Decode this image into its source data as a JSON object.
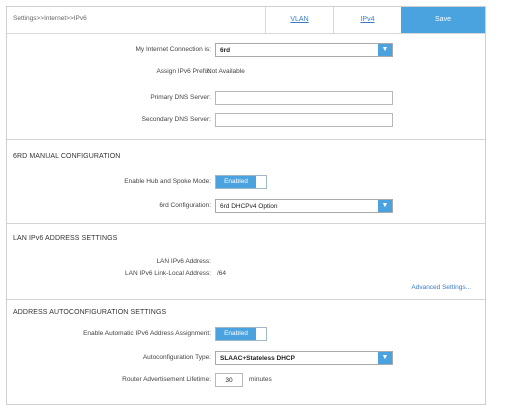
{
  "breadcrumb": "Settings>>Internet>>IPv6",
  "tabs": [
    {
      "label": "VLAN"
    },
    {
      "label": "IPv4"
    }
  ],
  "save_label": "Save",
  "connection": {
    "label": "My Internet Connection is:",
    "value": "6rd",
    "assign_label": "Assign IPv6 Prefix:",
    "assign_value": "Not Available",
    "primary_dns_label": "Primary DNS Server:",
    "primary_dns_value": "",
    "secondary_dns_label": "Secondary DNS Server:",
    "secondary_dns_value": ""
  },
  "sixrd": {
    "title": "6RD MANUAL CONFIGURATION",
    "hub_label": "Enable Hub and Spoke Mode:",
    "hub_state": "Enabled",
    "config_label": "6rd Configuration:",
    "config_value": "6rd DHCPv4 Option"
  },
  "lan": {
    "title": "LAN IPv6 ADDRESS SETTINGS",
    "address_label": "LAN IPv6 Address:",
    "address_value": "",
    "link_local_label": "LAN IPv6 Link-Local Address:",
    "link_local_value": "/64",
    "advanced_link": "Advanced Settings..."
  },
  "autoconf": {
    "title": "ADDRESS AUTOCONFIGURATION SETTINGS",
    "enable_label": "Enable Automatic IPv6 Address Assignment:",
    "enable_state": "Enabled",
    "type_label": "Autoconfiguration Type:",
    "type_value": "SLAAC+Stateless DHCP",
    "lifetime_label": "Router Advertisement Lifetime:",
    "lifetime_value": "30",
    "lifetime_unit": "minutes"
  },
  "colors": {
    "accent": "#4aa3df",
    "link": "#3a7bc8"
  }
}
